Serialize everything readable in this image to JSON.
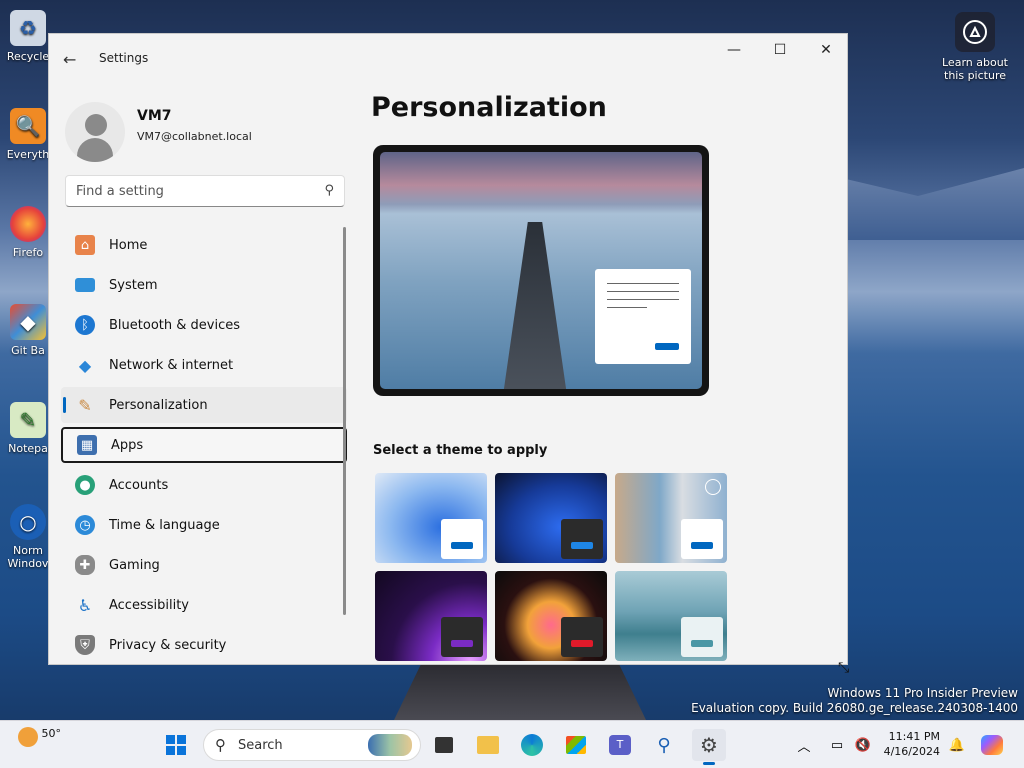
{
  "desktop": {
    "icons": [
      {
        "label": "Recycle",
        "icon": "recycle-bin-icon"
      },
      {
        "label": "Everyth",
        "icon": "everything-search-icon"
      },
      {
        "label": "Firefo",
        "icon": "firefox-icon"
      },
      {
        "label": "Git Ba",
        "icon": "git-bash-icon"
      },
      {
        "label": "Notepa",
        "icon": "notepad-plus-icon"
      },
      {
        "label": "Norm",
        "label2": "Windov",
        "icon": "window-icon"
      }
    ],
    "learn_label": "Learn about this picture",
    "watermark_line1": "Windows 11 Pro Insider Preview",
    "watermark_line2": "Evaluation copy. Build 26080.ge_release.240308-1400"
  },
  "window": {
    "title": "Settings",
    "controls": {
      "minimize": "—",
      "maximize": "☐",
      "close": "✕"
    },
    "user": {
      "name": "VM7",
      "email": "VM7@collabnet.local"
    },
    "search_placeholder": "Find a setting",
    "nav": [
      {
        "label": "Home",
        "icon": "home-icon",
        "color": "#e8834a"
      },
      {
        "label": "System",
        "icon": "system-icon",
        "color": "#2f8fd8"
      },
      {
        "label": "Bluetooth & devices",
        "icon": "bluetooth-icon",
        "color": "#1d77d1"
      },
      {
        "label": "Network & internet",
        "icon": "wifi-icon",
        "color": "#2a86d8"
      },
      {
        "label": "Personalization",
        "icon": "brush-icon",
        "color": "#c98a44",
        "selected": true
      },
      {
        "label": "Apps",
        "icon": "apps-icon",
        "color": "#3e6fae",
        "focused": true
      },
      {
        "label": "Accounts",
        "icon": "accounts-icon",
        "color": "#28a078"
      },
      {
        "label": "Time & language",
        "icon": "globe-clock-icon",
        "color": "#2c8ad8"
      },
      {
        "label": "Gaming",
        "icon": "gamepad-icon",
        "color": "#7d7d7d"
      },
      {
        "label": "Accessibility",
        "icon": "accessibility-icon",
        "color": "#1e73c8"
      },
      {
        "label": "Privacy & security",
        "icon": "shield-icon",
        "color": "#6d6d6d"
      }
    ],
    "page_title": "Personalization",
    "theme_section_label": "Select a theme to apply",
    "accent_color": "#0067c0"
  },
  "taskbar": {
    "weather": "50°",
    "search_label": "Search",
    "time": "11:41 PM",
    "date": "4/16/2024"
  }
}
